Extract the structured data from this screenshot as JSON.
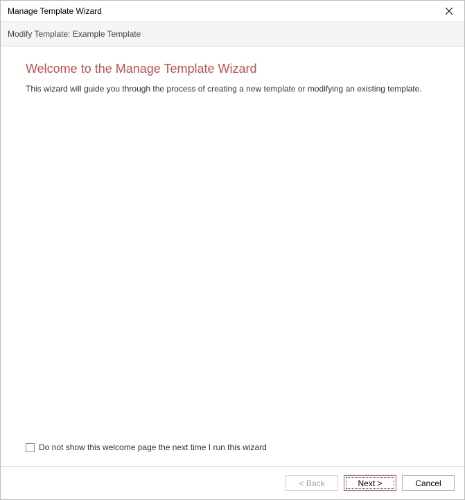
{
  "titlebar": {
    "title": "Manage Template Wizard"
  },
  "subheader": {
    "text": "Modify Template: Example Template"
  },
  "content": {
    "heading": "Welcome to the Manage Template Wizard",
    "description": "This wizard will guide you through the process of creating a new template or modifying an existing template.",
    "checkbox_label": "Do not show this welcome page the next time I run this wizard"
  },
  "footer": {
    "back_label": "< Back",
    "next_label": "Next >",
    "cancel_label": "Cancel"
  }
}
